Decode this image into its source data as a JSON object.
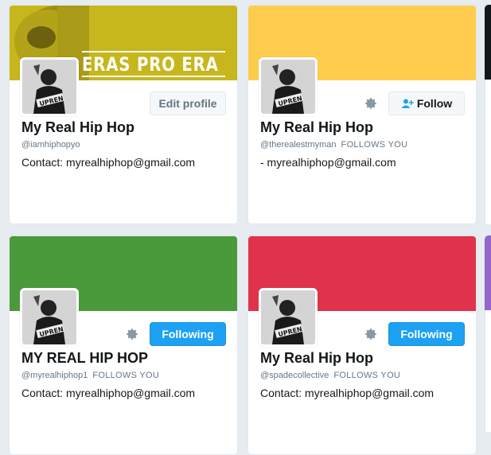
{
  "colors": {
    "page_bg": "#e6ecf0",
    "banner_yellow_photo": "#c9b81e",
    "banner_yellow": "#ffcc4d",
    "banner_green": "#4a9a3c",
    "banner_red": "#e0324a",
    "follow_blue": "#1da1f2",
    "edge_purple": "#9266cc"
  },
  "cards": [
    {
      "banner_text": "ERAS PRO ERA",
      "name": "My Real Hip Hop",
      "handle": "@iamhiphopyo",
      "follows_you": "",
      "bio": "Contact: myrealhiphop@gmail.com",
      "button": "Edit profile",
      "avatar_text": "UPREN"
    },
    {
      "name": "My Real Hip Hop",
      "handle": "@therealestmyman",
      "follows_you": "FOLLOWS YOU",
      "bio": "- myrealhiphop@gmail.com",
      "button": "Follow",
      "avatar_text": "UPREN"
    },
    {
      "name": "MY REAL HIP HOP",
      "handle": "@myrealhiphop1",
      "follows_you": "FOLLOWS YOU",
      "bio": "Contact: myrealhiphop@gmail.com",
      "button": "Following",
      "avatar_text": "UPREN"
    },
    {
      "name": "My Real Hip Hop",
      "handle": "@spadecollective",
      "follows_you": "FOLLOWS YOU",
      "bio": "Contact: myrealhiphop@gmail.com",
      "button": "Following",
      "avatar_text": "UPREN"
    }
  ],
  "icons": {
    "gear": "gear-icon",
    "follow": "add-user-icon"
  }
}
